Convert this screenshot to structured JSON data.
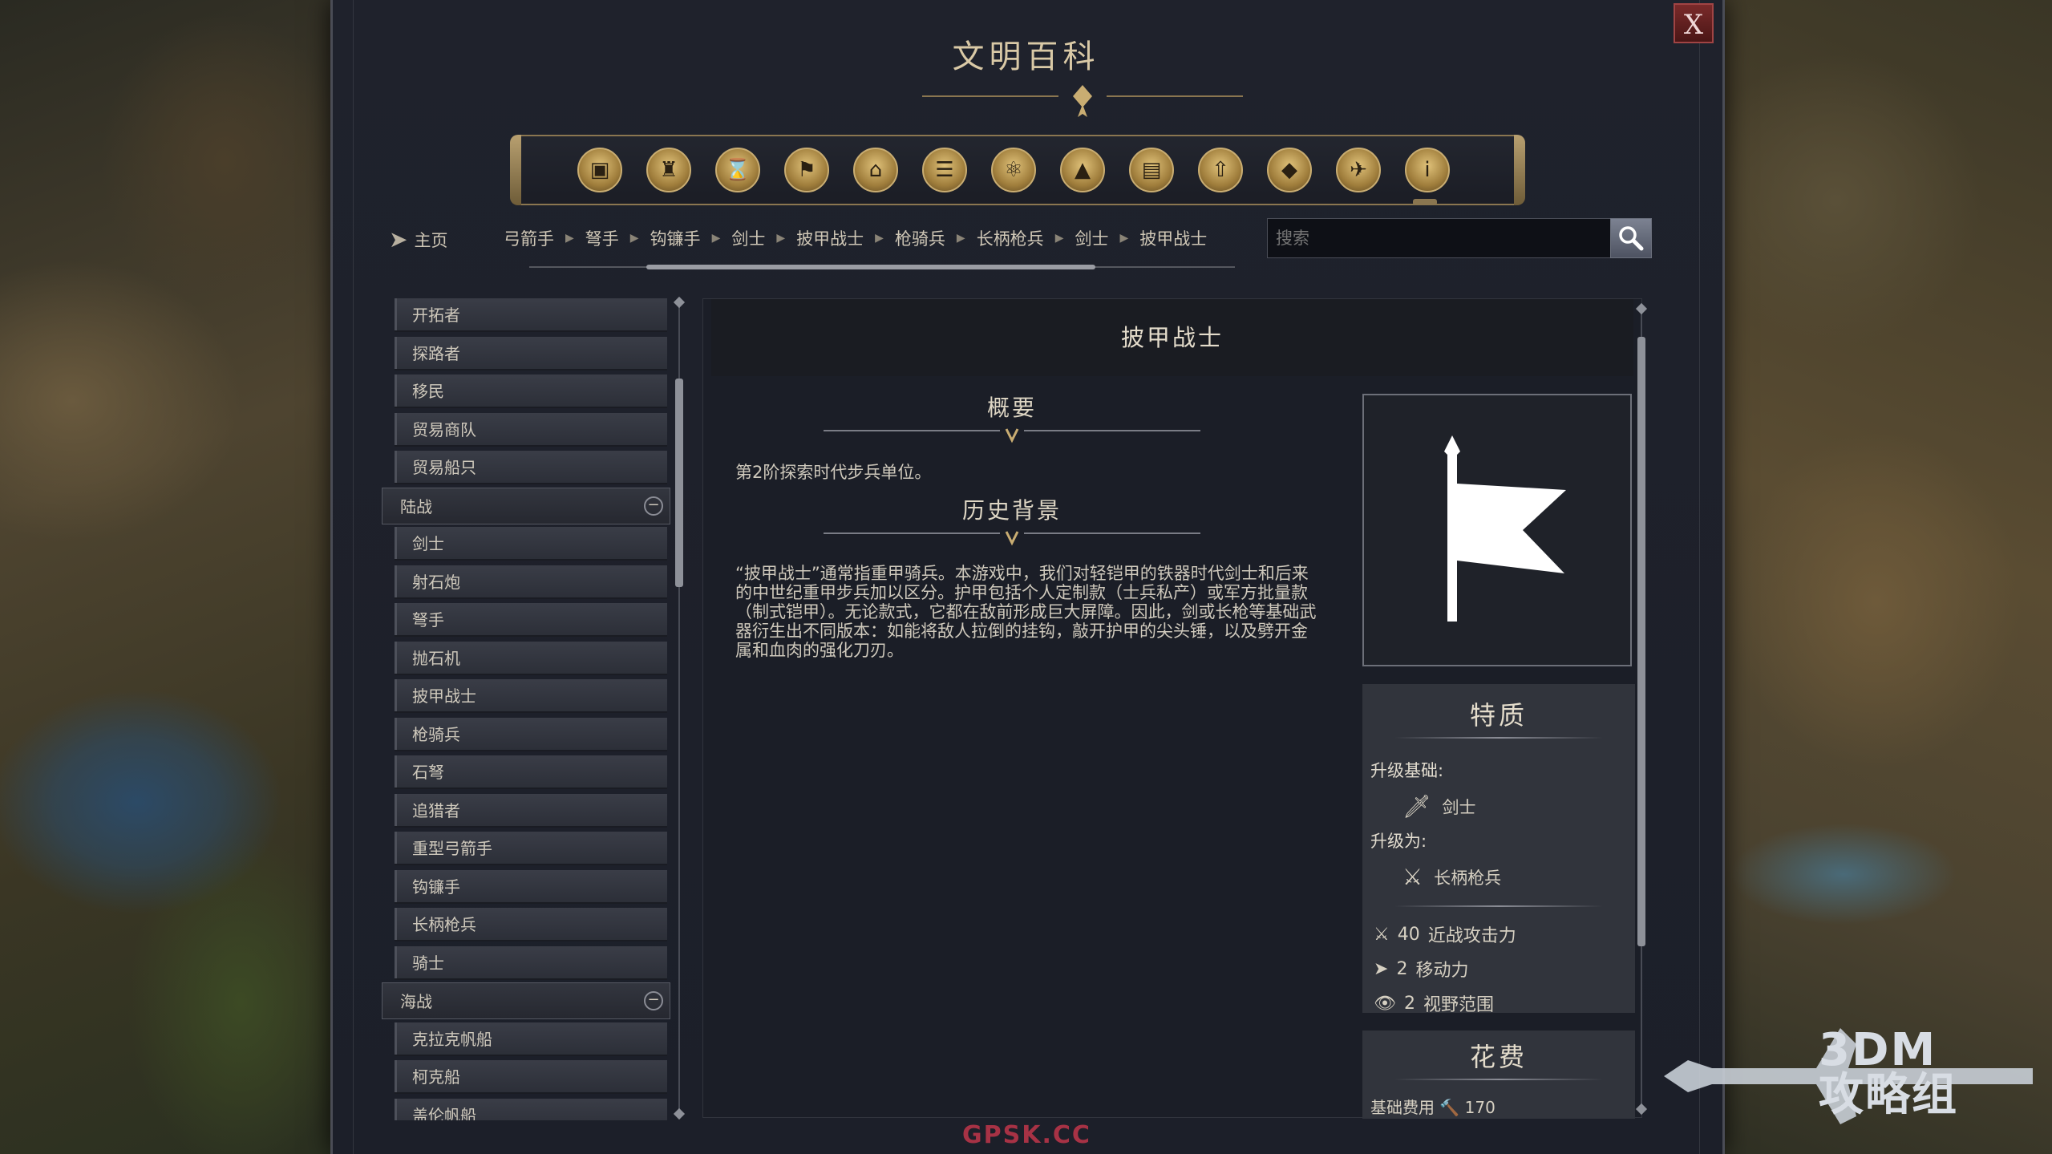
{
  "window": {
    "title": "文明百科",
    "close_label": "X"
  },
  "category_icons": [
    {
      "name": "overview-box-icon",
      "glyph": "▣"
    },
    {
      "name": "goblet-icon",
      "glyph": "♜"
    },
    {
      "name": "hourglass-icon",
      "glyph": "⌛"
    },
    {
      "name": "flag-icon",
      "glyph": "⚑"
    },
    {
      "name": "museum-icon",
      "glyph": "⌂"
    },
    {
      "name": "open-book-icon",
      "glyph": "☰"
    },
    {
      "name": "atom-icon",
      "glyph": "⚛"
    },
    {
      "name": "mountain-icon",
      "glyph": "▲"
    },
    {
      "name": "district-icon",
      "glyph": "▤"
    },
    {
      "name": "up-arrow-icon",
      "glyph": "⇧"
    },
    {
      "name": "crystal-icon",
      "glyph": "◆"
    },
    {
      "name": "dove-icon",
      "glyph": "✈"
    },
    {
      "name": "info-icon",
      "glyph": "i"
    }
  ],
  "nav": {
    "home_label": "主页",
    "breadcrumb": [
      "弓箭手",
      "弩手",
      "钩镰手",
      "剑士",
      "披甲战士",
      "枪骑兵",
      "长柄枪兵",
      "剑士",
      "披甲战士"
    ],
    "search_placeholder": "搜索"
  },
  "unit_list": [
    {
      "type": "item",
      "label": "开拓者"
    },
    {
      "type": "item",
      "label": "探路者"
    },
    {
      "type": "item",
      "label": "移民"
    },
    {
      "type": "item",
      "label": "贸易商队"
    },
    {
      "type": "item",
      "label": "贸易船只"
    },
    {
      "type": "group",
      "label": "陆战"
    },
    {
      "type": "item",
      "label": "剑士"
    },
    {
      "type": "item",
      "label": "射石炮"
    },
    {
      "type": "item",
      "label": "弩手"
    },
    {
      "type": "item",
      "label": "抛石机"
    },
    {
      "type": "item",
      "label": "披甲战士"
    },
    {
      "type": "item",
      "label": "枪骑兵"
    },
    {
      "type": "item",
      "label": "石弩"
    },
    {
      "type": "item",
      "label": "追猎者"
    },
    {
      "type": "item",
      "label": "重型弓箭手"
    },
    {
      "type": "item",
      "label": "钩镰手"
    },
    {
      "type": "item",
      "label": "长柄枪兵"
    },
    {
      "type": "item",
      "label": "骑士"
    },
    {
      "type": "group",
      "label": "海战"
    },
    {
      "type": "item",
      "label": "克拉克帆船"
    },
    {
      "type": "item",
      "label": "柯克船"
    },
    {
      "type": "item",
      "label": "盖伦帆船"
    }
  ],
  "detail": {
    "title": "披甲战士",
    "summary_heading": "概要",
    "summary_text": "第2阶探索时代步兵单位。",
    "history_heading": "历史背景",
    "history_text": "“披甲战士”通常指重甲骑兵。本游戏中，我们对轻铠甲的铁器时代剑士和后来的中世纪重甲步兵加以区分。护甲包括个人定制款（士兵私产）或军方批量款（制式铠甲）。无论款式，它都在敌前形成巨大屏障。因此，剑或长枪等基础武器衍生出不同版本：如能将敌人拉倒的挂钩，敲开护甲的尖头锤，以及劈开金属和血肉的强化刀刃。",
    "portrait_icon": "banner-flag-icon"
  },
  "traits": {
    "title": "特质",
    "upgrade_from_label": "升级基础:",
    "upgrade_from_unit": "剑士",
    "upgrade_to_label": "升级为:",
    "upgrade_to_unit": "长柄枪兵",
    "stats": [
      {
        "icon": "sword-icon",
        "glyph": "⚔",
        "value": "40",
        "label": "近战攻击力"
      },
      {
        "icon": "movement-arrow-icon",
        "glyph": "➤",
        "value": "2",
        "label": "移动力"
      },
      {
        "icon": "eye-icon",
        "glyph": "👁",
        "value": "2",
        "label": "视野范围"
      }
    ]
  },
  "cost": {
    "title": "花费",
    "base_cost_label": "基础费用",
    "base_cost_value": "170"
  },
  "watermark": {
    "brand": "3DM",
    "group": "攻略组",
    "bottom": "GPSK.CC"
  },
  "colors": {
    "accent_gold": "#c9ad72",
    "panel": "#1b1e27",
    "close_red": "#7a2a2a"
  }
}
